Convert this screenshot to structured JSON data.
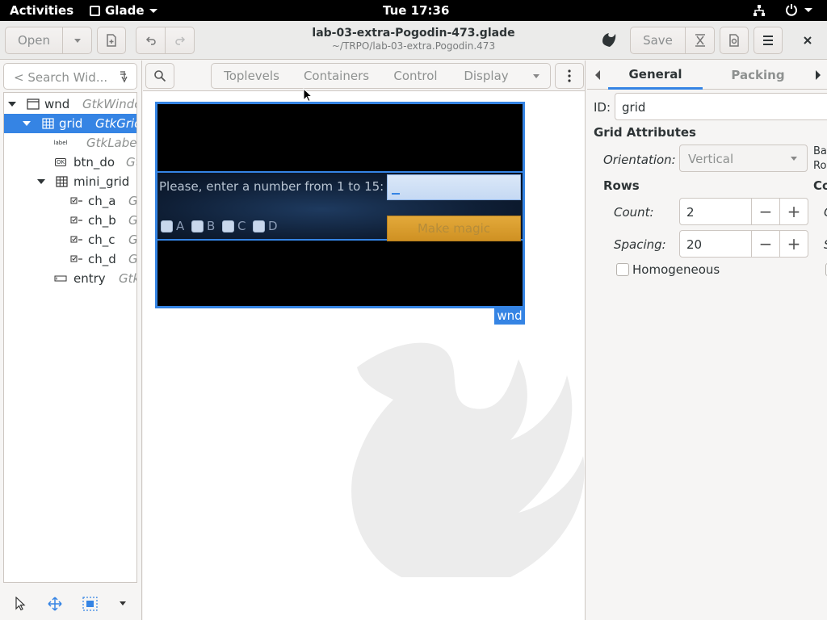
{
  "topbar": {
    "activities": "Activities",
    "app_name": "Glade",
    "clock": "Tue 17:36"
  },
  "header": {
    "open_label": "Open",
    "title": "lab-03-extra-Pogodin-473.glade",
    "subtitle": "~/TRPO/lab-03-extra.Pogodin.473",
    "save_label": "Save"
  },
  "left": {
    "search_placeholder": "< Search Wid...",
    "tree": [
      {
        "name": "wnd",
        "type": "GtkWindow",
        "icon": "window-icon",
        "expanded": true
      },
      {
        "name": "grid",
        "type": "GtkGrid",
        "icon": "grid-icon",
        "expanded": true,
        "selected": true
      },
      {
        "name": "",
        "type": "GtkLabel",
        "icon": "label-icon",
        "icon_text": "label"
      },
      {
        "name": "btn_do",
        "type": "GtkButton",
        "icon": "button-icon",
        "icon_text": "OK"
      },
      {
        "name": "mini_grid",
        "type": "GtkGrid",
        "icon": "grid-icon",
        "expanded": true
      },
      {
        "name": "ch_a",
        "type": "GtkCheckButton",
        "icon": "checkbutton-icon"
      },
      {
        "name": "ch_b",
        "type": "GtkCheckButton",
        "icon": "checkbutton-icon"
      },
      {
        "name": "ch_c",
        "type": "GtkCheckButton",
        "icon": "checkbutton-icon"
      },
      {
        "name": "ch_d",
        "type": "GtkCheckButton",
        "icon": "checkbutton-icon"
      },
      {
        "name": "entry",
        "type": "GtkEntry",
        "icon": "entry-icon"
      }
    ]
  },
  "palette": {
    "groups": [
      "Toplevels",
      "Containers",
      "Control",
      "Display"
    ]
  },
  "canvas": {
    "prompt_label": "Please, enter a number from 1 to 15:",
    "checkboxes": [
      "A",
      "B",
      "C",
      "D"
    ],
    "button_label": "Make magic",
    "window_tag": "wnd"
  },
  "inspector": {
    "tabs": [
      "General",
      "Packing"
    ],
    "id_label": "ID:",
    "id_value": "grid",
    "section_title": "Grid Attributes",
    "orientation_label": "Orientation:",
    "orientation_value": "Vertical",
    "baseline_partial": "Ba",
    "baseline_row_partial": "Ro",
    "rows_title": "Rows",
    "columns_partial": "Co",
    "count_label": "Count:",
    "count_value": "2",
    "spacing_label": "Spacing:",
    "spacing_value": "20",
    "homogeneous_label": "Homogeneous",
    "col_count_partial": "C",
    "col_spacing_partial": "S"
  }
}
